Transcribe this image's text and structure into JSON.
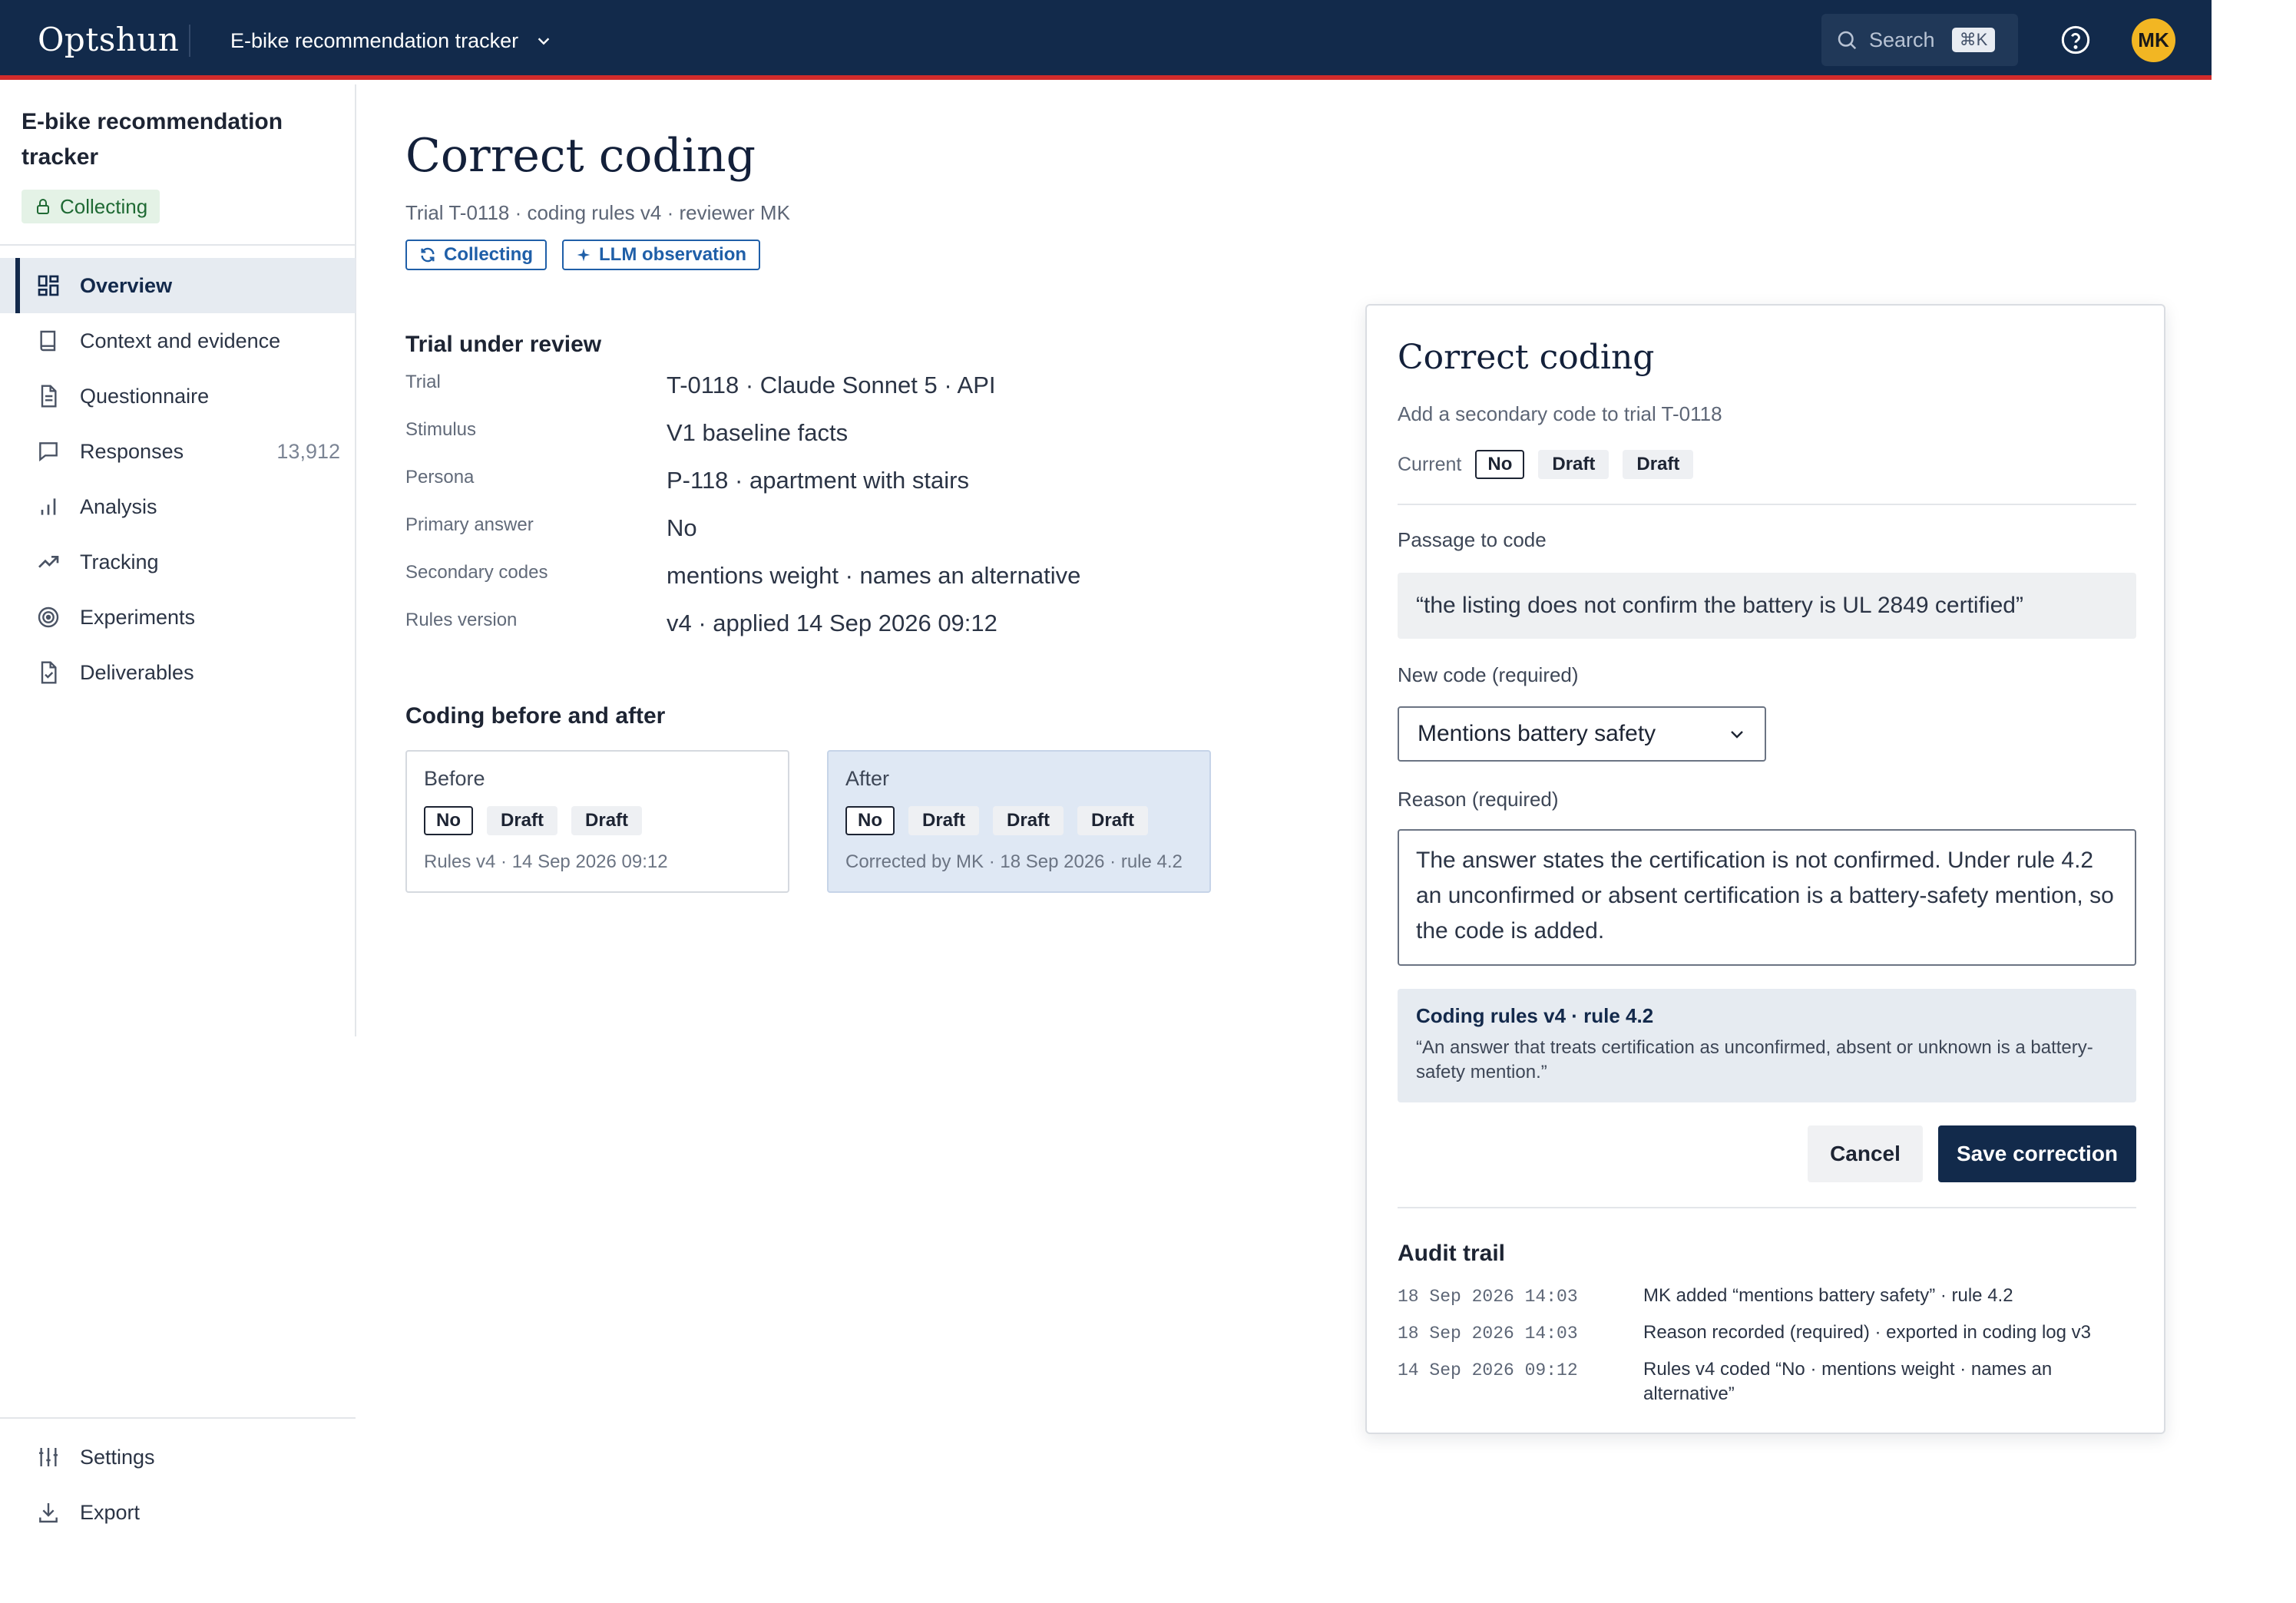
{
  "header": {
    "logo": "Optshun",
    "project": "E-bike recommendation tracker",
    "search_label": "Search",
    "search_shortcut": "⌘K",
    "avatar_initials": "MK",
    "colors": {
      "bar": "#122a4b",
      "accent_line": "#d22b2b",
      "avatar": "#f2b623"
    }
  },
  "sidebar": {
    "title": "E-bike recommendation tracker",
    "status": "Collecting",
    "items": [
      {
        "label": "Overview",
        "icon": "grid-icon",
        "active": true
      },
      {
        "label": "Context and evidence",
        "icon": "book-icon"
      },
      {
        "label": "Questionnaire",
        "icon": "document-icon"
      },
      {
        "label": "Responses",
        "icon": "chat-icon",
        "count": "13,912"
      },
      {
        "label": "Analysis",
        "icon": "bar-chart-icon"
      },
      {
        "label": "Tracking",
        "icon": "trend-icon"
      },
      {
        "label": "Experiments",
        "icon": "target-icon"
      },
      {
        "label": "Deliverables",
        "icon": "file-check-icon"
      }
    ],
    "bottom_items": [
      {
        "label": "Settings",
        "icon": "sliders-icon"
      },
      {
        "label": "Export",
        "icon": "download-icon"
      }
    ]
  },
  "main": {
    "title": "Correct coding",
    "subtitle": "Trial T-0118 · coding rules v4 · reviewer MK",
    "tags": [
      {
        "label": "Collecting",
        "icon": "refresh-icon"
      },
      {
        "label": "LLM observation",
        "icon": "sparkle-icon"
      }
    ],
    "trial_section_title": "Trial under review",
    "trial_fields": [
      {
        "key": "Trial",
        "value": "T-0118 · Claude Sonnet 5 · API"
      },
      {
        "key": "Stimulus",
        "value": "V1 baseline facts"
      },
      {
        "key": "Persona",
        "value": "P-118 · apartment with stairs"
      },
      {
        "key": "Primary answer",
        "value": "No"
      },
      {
        "key": "Secondary codes",
        "value": "mentions weight · names an alternative"
      },
      {
        "key": "Rules version",
        "value": "v4 · applied 14 Sep 2026 09:12"
      }
    ],
    "compare_section_title": "Coding before and after",
    "before": {
      "heading": "Before",
      "chips": [
        "No",
        "Draft",
        "Draft"
      ],
      "footer": "Rules v4 · 14 Sep 2026 09:12"
    },
    "after": {
      "heading": "After",
      "chips": [
        "No",
        "Draft",
        "Draft",
        "Draft"
      ],
      "footer": "Corrected by MK · 18 Sep 2026 · rule 4.2"
    }
  },
  "panel": {
    "title": "Correct coding",
    "subtitle": "Add a secondary code to trial T-0118",
    "current_label": "Current",
    "current_chips": [
      "No",
      "Draft",
      "Draft"
    ],
    "passage_label": "Passage to code",
    "passage": "“the listing does not confirm the battery is UL 2849 certified”",
    "new_code_label": "New code (required)",
    "new_code_value": "Mentions battery safety",
    "reason_label": "Reason (required)",
    "reason_value": "The answer states the certification is not confirmed. Under rule 4.2 an unconfirmed or absent certification is a battery-safety mention, so the code is added.",
    "rule_title": "Coding rules v4 · rule 4.2",
    "rule_text": "“An answer that treats certification as unconfirmed, absent or unknown is a battery-safety mention.”",
    "cancel_label": "Cancel",
    "save_label": "Save correction",
    "audit_title": "Audit trail",
    "audit": [
      {
        "time": "18 Sep 2026 14:03",
        "text": "MK added “mentions battery safety” · rule 4.2"
      },
      {
        "time": "18 Sep 2026 14:03",
        "text": "Reason recorded (required) · exported in coding log v3"
      },
      {
        "time": "14 Sep 2026 09:12",
        "text": "Rules v4 coded “No · mentions weight · names an alternative”"
      }
    ]
  }
}
